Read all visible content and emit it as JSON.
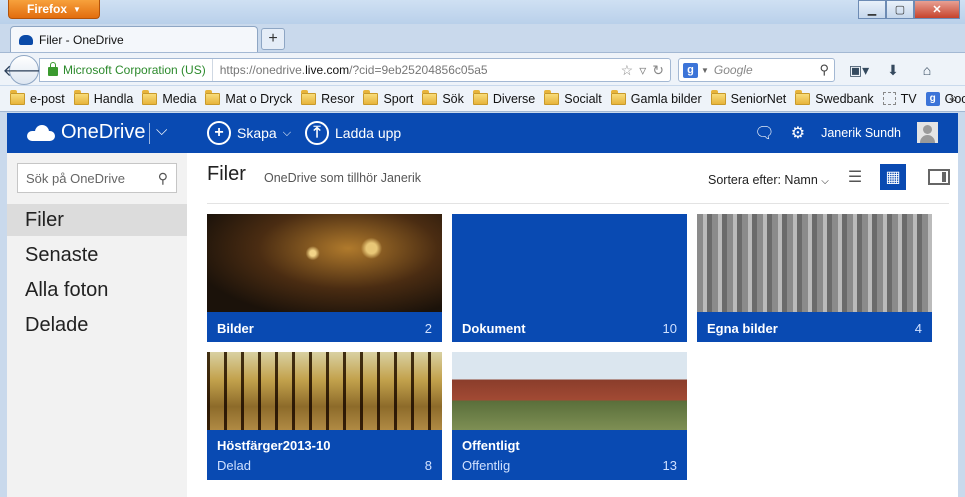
{
  "browser": {
    "menu_label": "Firefox",
    "tab_title": "Filer - OneDrive",
    "identity": "Microsoft Corporation (US)",
    "url_prefix": "https://onedrive.",
    "url_domain": "live.com",
    "url_suffix": "/?cid=9eb25204856c05a5",
    "search_placeholder": "Google",
    "bookmarks": [
      {
        "label": "e-post",
        "icon": "folder-icon"
      },
      {
        "label": "Handla",
        "icon": "folder-icon"
      },
      {
        "label": "Media",
        "icon": "folder-icon"
      },
      {
        "label": "Mat o Dryck",
        "icon": "folder-icon"
      },
      {
        "label": "Resor",
        "icon": "folder-icon"
      },
      {
        "label": "Sport",
        "icon": "folder-icon"
      },
      {
        "label": "Sök",
        "icon": "folder-icon"
      },
      {
        "label": "Diverse",
        "icon": "folder-icon"
      },
      {
        "label": "Socialt",
        "icon": "folder-icon"
      },
      {
        "label": "Gamla bilder",
        "icon": "folder-icon"
      },
      {
        "label": "SeniorNet",
        "icon": "folder-icon"
      },
      {
        "label": "Swedbank",
        "icon": "folder-icon"
      },
      {
        "label": "TV",
        "icon": "blank-page-icon"
      },
      {
        "label": "Google",
        "icon": "google-icon"
      }
    ]
  },
  "onedrive": {
    "brand": "OneDrive",
    "create_label": "Skapa",
    "upload_label": "Ladda upp",
    "user_name": "Janerik Sundh",
    "search_placeholder": "Sök på OneDrive",
    "nav": [
      "Filer",
      "Senaste",
      "Alla foton",
      "Delade"
    ],
    "page_title": "Filer",
    "subtitle": "OneDrive som tillhör Janerik",
    "sort_label": "Sortera efter: Namn",
    "folders": [
      {
        "name": "Bilder",
        "count": "2",
        "sub": ""
      },
      {
        "name": "Dokument",
        "count": "10",
        "sub": ""
      },
      {
        "name": "Egna bilder",
        "count": "4",
        "sub": ""
      },
      {
        "name": "Höstfärger2013-10",
        "count": "8",
        "sub": "Delad"
      },
      {
        "name": "Offentligt",
        "count": "13",
        "sub": "Offentlig"
      }
    ]
  },
  "colors": {
    "brand_blue": "#094ab2",
    "firefox_orange": "#e26d0e"
  }
}
